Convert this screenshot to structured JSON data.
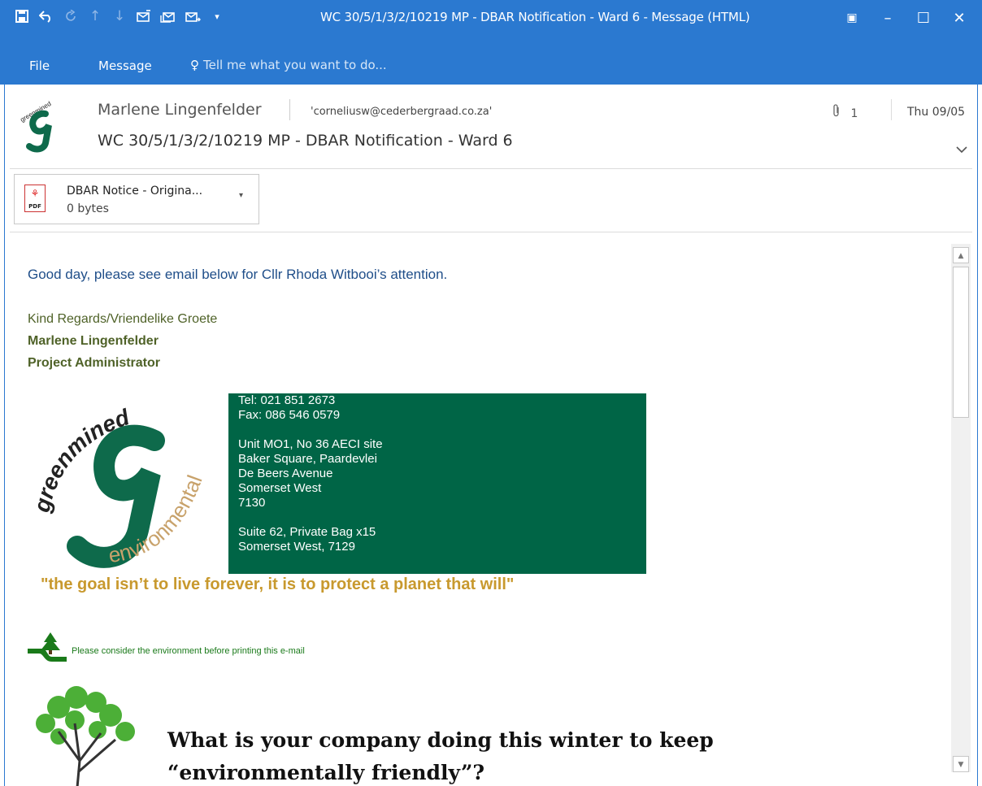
{
  "window": {
    "title": "WC 30/5/1/3/2/10219 MP - DBAR Notification - Ward 6 - Message (HTML)",
    "controls": {
      "ribbon_options": "▣",
      "minimize": "–",
      "maximize": "☐",
      "close": "✕"
    }
  },
  "quick_access": [
    "save-icon",
    "undo-icon",
    "redo-icon",
    "up-arrow-icon",
    "down-arrow-icon",
    "reply-icon",
    "reply-all-icon",
    "forward-icon",
    "customize-icon"
  ],
  "menu": {
    "file": "File",
    "message": "Message",
    "tell_me": "Tell me what you want to do..."
  },
  "header": {
    "sender": "Marlene Lingenfelder",
    "to": "'corneliusw@cederbergraad.co.za'",
    "attachments_count": "1",
    "date": "Thu 09/05",
    "subject": "WC 30/5/1/3/2/10219 MP - DBAR Notification - Ward 6",
    "logo_text": "greenmined"
  },
  "attachment": {
    "name": "DBAR Notice - Origina...",
    "size": "0 bytes",
    "icon_label": "PDF"
  },
  "body": {
    "greeting": "Good day, please see email below for Cllr Rhoda Witbooi’s attention.",
    "regards": "Kind Regards/Vriendelike Groete",
    "name": "Marlene Lingenfelder",
    "role": "Project Administrator",
    "logo_words": {
      "top": "greenmined",
      "side": "environmental"
    },
    "contact_lines": [
      "Tel: 021 851 2673",
      "Fax: 086 546 0579",
      "",
      "Unit MO1, No 36 AECI site",
      "Baker Square, Paardevlei",
      "De Beers Avenue",
      "Somerset West",
      "7130",
      "",
      "Suite 62, Private Bag x15",
      "Somerset West, 7129"
    ],
    "quote": "\"the goal isn’t to live forever, it is to protect a planet that will\"",
    "print_note": "Please consider the environment before printing this e-mail",
    "winter_line1": "What is your company doing this winter to keep",
    "winter_line2": "“environmentally friendly”?"
  },
  "colors": {
    "accent": "#2b79d0",
    "signature_box": "#006546",
    "quote": "#c8992e",
    "greeting": "#1f4e89",
    "signature": "#4f6228"
  }
}
